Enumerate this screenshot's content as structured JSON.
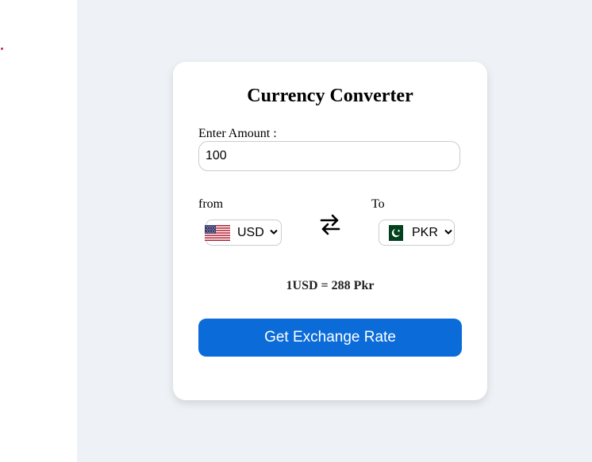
{
  "title": "Currency Converter",
  "amount": {
    "label": "Enter Amount :",
    "value": "100"
  },
  "from": {
    "label": "from",
    "currency": "USD",
    "flag": "us-flag-icon"
  },
  "to": {
    "label": "To",
    "currency": "PKR",
    "flag": "pk-flag-icon"
  },
  "swap_icon": "swap-arrows-icon",
  "rate_text": "1USD = 288 Pkr",
  "button_label": "Get Exchange Rate",
  "colors": {
    "background": "#eef1f6",
    "card": "#ffffff",
    "button": "#0a6bd9",
    "button_text": "#ffffff"
  }
}
